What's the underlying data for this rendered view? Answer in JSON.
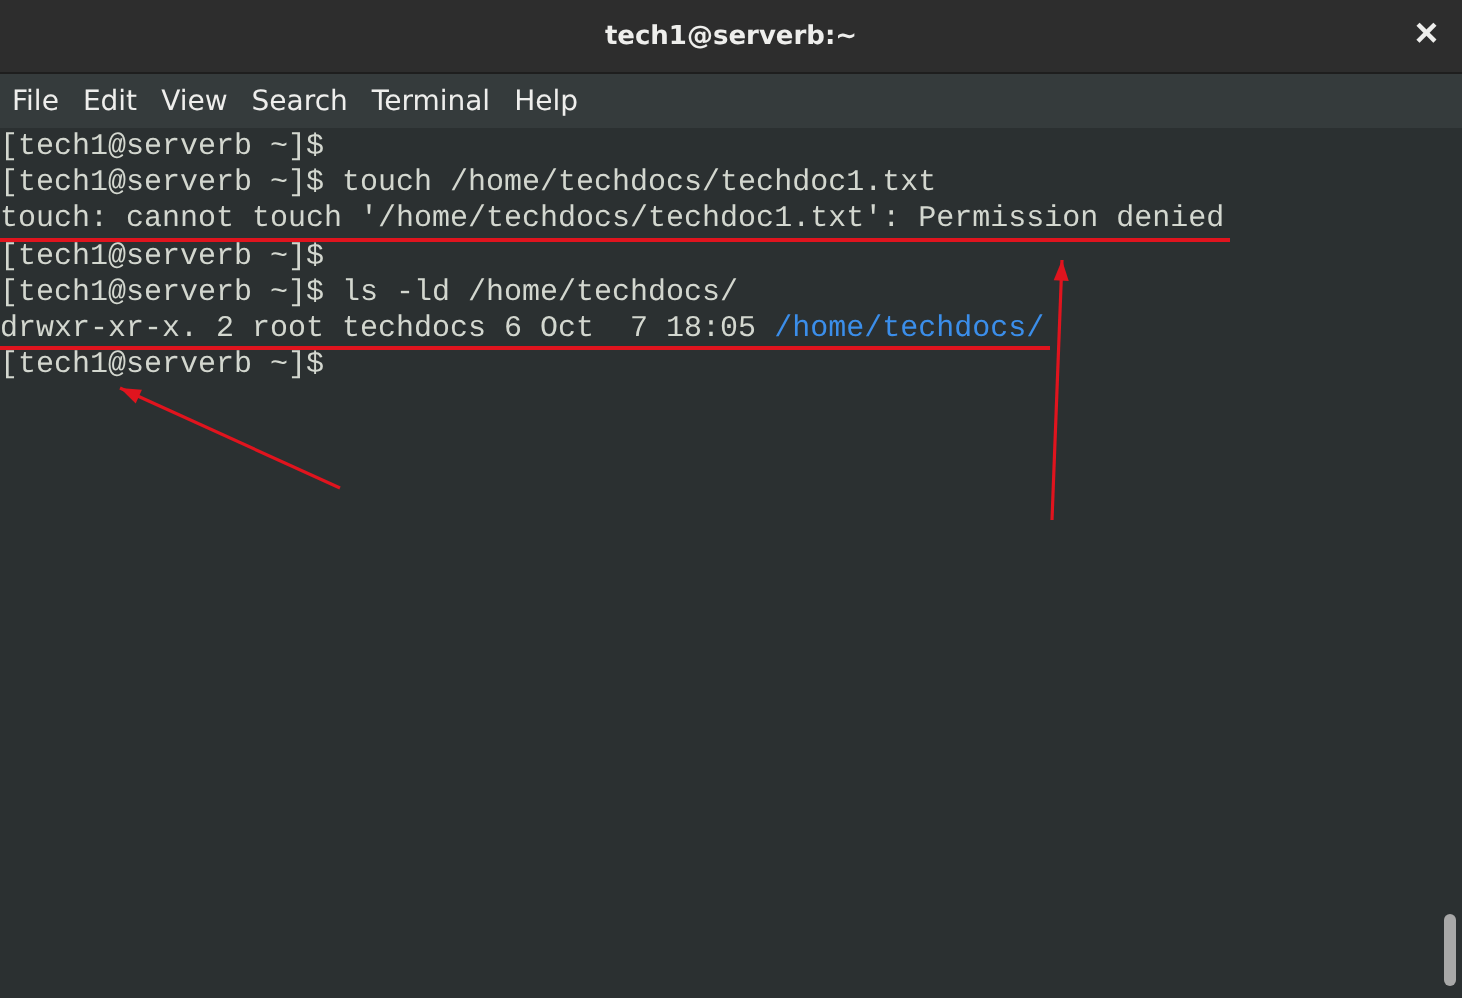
{
  "window": {
    "title": "tech1@serverb:~",
    "close": "×"
  },
  "menu": [
    "File",
    "Edit",
    "View",
    "Search",
    "Terminal",
    "Help"
  ],
  "terminal": {
    "lines": [
      {
        "underlined": false,
        "segments": [
          {
            "kind": "plain",
            "text": "[tech1@serverb ~]$"
          }
        ]
      },
      {
        "underlined": false,
        "segments": [
          {
            "kind": "plain",
            "text": "[tech1@serverb ~]$ touch /home/techdocs/techdoc1.txt"
          }
        ]
      },
      {
        "underlined": true,
        "segments": [
          {
            "kind": "plain",
            "text": "touch: cannot touch '/home/techdocs/techdoc1.txt': Permission denied"
          }
        ]
      },
      {
        "underlined": false,
        "segments": [
          {
            "kind": "plain",
            "text": "[tech1@serverb ~]$"
          }
        ]
      },
      {
        "underlined": false,
        "segments": [
          {
            "kind": "plain",
            "text": "[tech1@serverb ~]$ ls -ld /home/techdocs/"
          }
        ]
      },
      {
        "underlined": true,
        "segments": [
          {
            "kind": "plain",
            "text": "drwxr-xr-x. 2 root techdocs 6 Oct  7 18:05 "
          },
          {
            "kind": "directory",
            "text": "/home/techdocs/"
          }
        ]
      },
      {
        "underlined": false,
        "segments": [
          {
            "kind": "plain",
            "text": "[tech1@serverb ~]$"
          }
        ]
      }
    ]
  }
}
